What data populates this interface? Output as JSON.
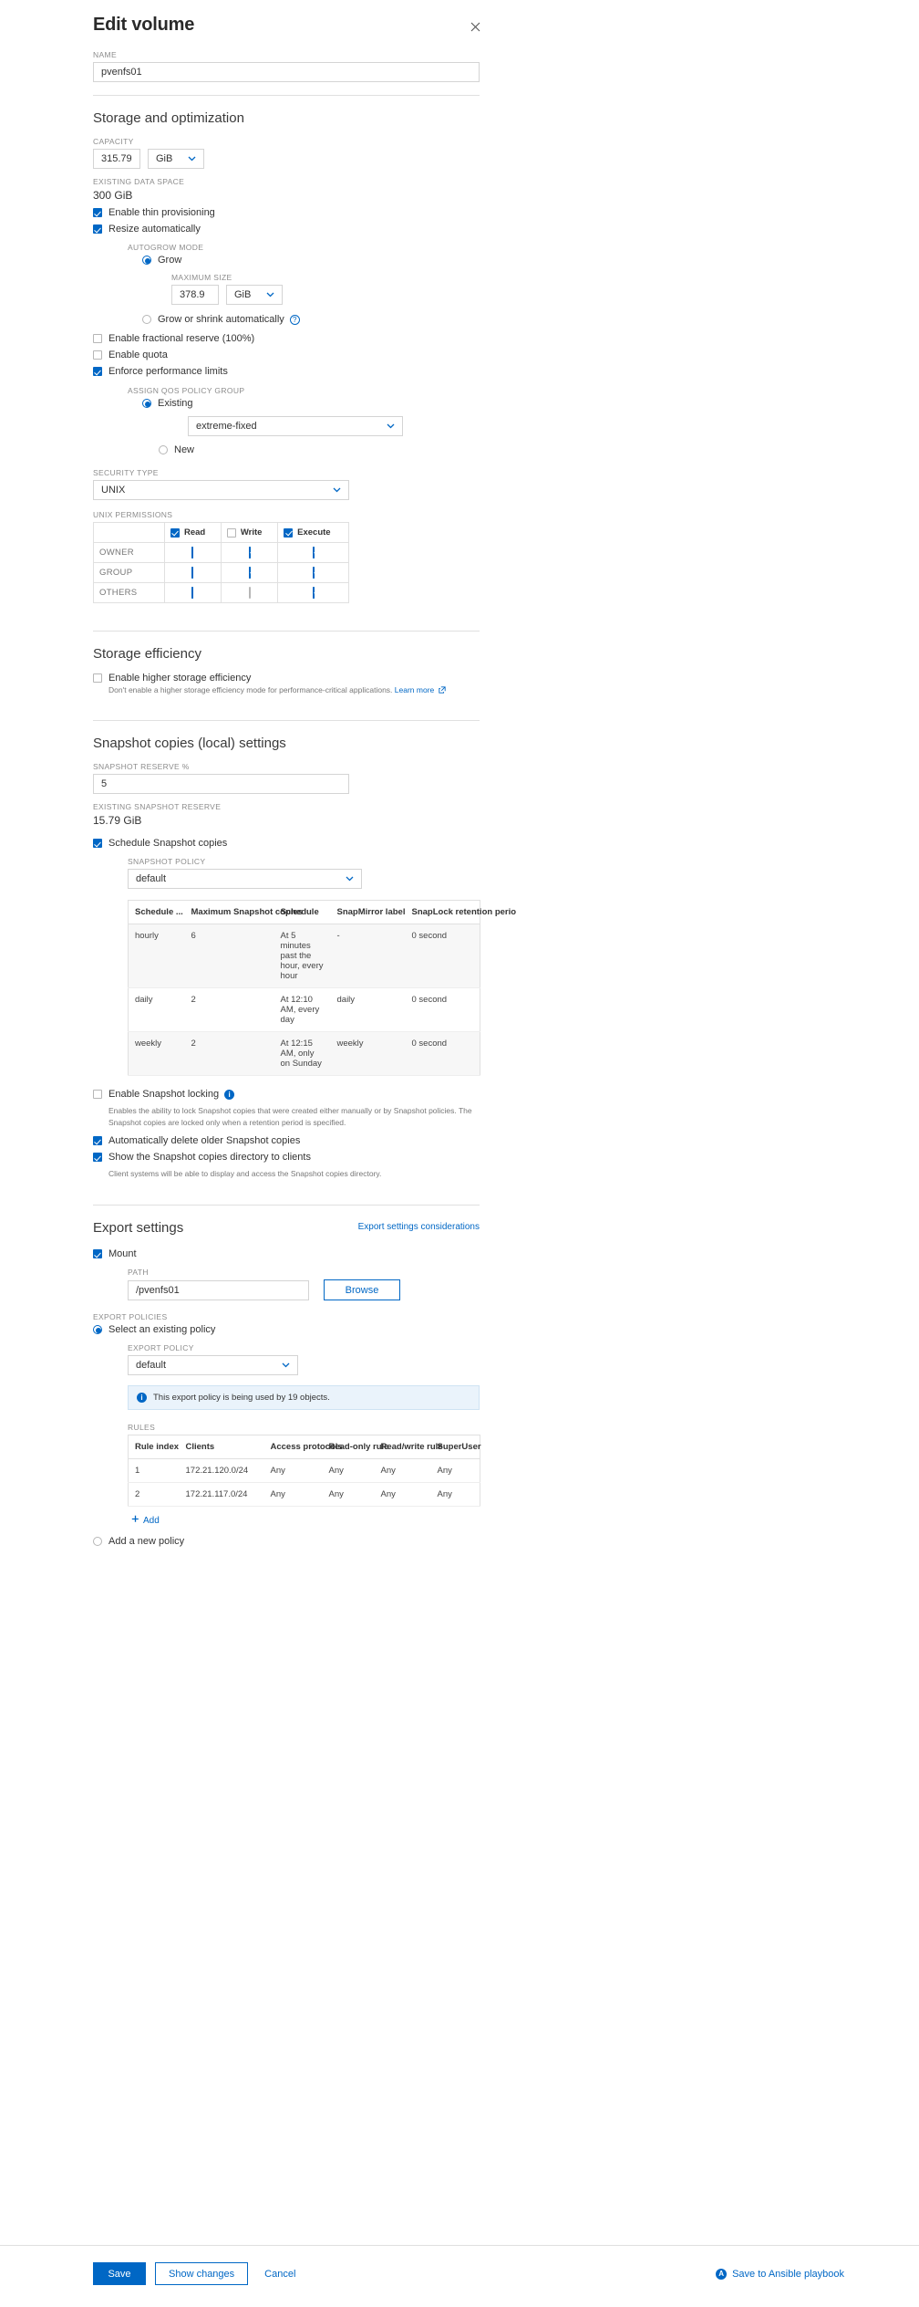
{
  "dialog": {
    "title": "Edit volume",
    "close_icon": "close-icon"
  },
  "name_field": {
    "label": "NAME",
    "value": "pvenfs01"
  },
  "storage": {
    "heading": "Storage and optimization",
    "capacity_label": "CAPACITY",
    "capacity_value": "315.79",
    "capacity_unit": "GiB",
    "existing_data_space_label": "EXISTING DATA SPACE",
    "existing_data_space_value": "300 GiB",
    "thin_provisioning_label": "Enable thin provisioning",
    "thin_provisioning_checked": true,
    "resize_auto_label": "Resize automatically",
    "resize_auto_checked": true,
    "autogrow_mode_label": "AUTOGROW MODE",
    "grow_label": "Grow",
    "grow_selected": true,
    "maximum_size_label": "MAXIMUM SIZE",
    "maximum_size_value": "378.9",
    "maximum_size_unit": "GiB",
    "grow_shrink_label": "Grow or shrink automatically",
    "grow_shrink_selected": false,
    "help_icon": "help-circle-icon",
    "fractional_reserve_label": "Enable fractional reserve (100%)",
    "fractional_reserve_checked": false,
    "quota_label": "Enable quota",
    "quota_checked": false,
    "perf_limits_label": "Enforce performance limits",
    "perf_limits_checked": true,
    "qos_group_label": "ASSIGN QOS POLICY GROUP",
    "qos_existing_label": "Existing",
    "qos_existing_selected": true,
    "qos_policy_value": "extreme-fixed",
    "qos_new_label": "New",
    "qos_new_selected": false,
    "security_type_label": "SECURITY TYPE",
    "security_type_value": "UNIX",
    "unix_permissions_label": "UNIX PERMISSIONS"
  },
  "unix_permissions": {
    "columns": [
      "Read",
      "Write",
      "Execute"
    ],
    "header_checked": [
      true,
      false,
      true
    ],
    "rows": [
      {
        "label": "OWNER",
        "values": [
          true,
          true,
          true
        ]
      },
      {
        "label": "GROUP",
        "values": [
          true,
          true,
          true
        ]
      },
      {
        "label": "OTHERS",
        "values": [
          true,
          false,
          true
        ]
      }
    ]
  },
  "storage_efficiency": {
    "heading": "Storage efficiency",
    "checkbox_label": "Enable higher storage efficiency",
    "checked": false,
    "note": "Don't enable a higher storage efficiency mode for performance-critical applications.",
    "learn_more": "Learn more",
    "external_icon": "external-link-icon"
  },
  "snapshot": {
    "heading": "Snapshot copies (local) settings",
    "reserve_label": "SNAPSHOT RESERVE %",
    "reserve_value": "5",
    "existing_reserve_label": "EXISTING SNAPSHOT RESERVE",
    "existing_reserve_value": "15.79 GiB",
    "schedule_label": "Schedule Snapshot copies",
    "schedule_checked": true,
    "policy_label": "SNAPSHOT POLICY",
    "policy_value": "default",
    "table": {
      "columns": [
        "Schedule ...",
        "Maximum Snapshot copies",
        "Schedule",
        "SnapMirror label",
        "SnapLock retention perio"
      ],
      "rows": [
        [
          "hourly",
          "6",
          "At 5 minutes past the hour, every hour",
          "-",
          "0 second"
        ],
        [
          "daily",
          "2",
          "At 12:10 AM, every day",
          "daily",
          "0 second"
        ],
        [
          "weekly",
          "2",
          "At 12:15 AM, only on Sunday",
          "weekly",
          "0 second"
        ]
      ]
    },
    "locking_label": "Enable Snapshot locking",
    "locking_checked": false,
    "locking_info_icon": "info-icon",
    "locking_note": "Enables the ability to lock Snapshot copies that were created either manually or by Snapshot policies. The Snapshot copies are locked only when a retention period is specified.",
    "auto_delete_label": "Automatically delete older Snapshot copies",
    "auto_delete_checked": true,
    "show_dir_label": "Show the Snapshot copies directory to clients",
    "show_dir_checked": true,
    "show_dir_note": "Client systems will be able to display and access the Snapshot copies directory."
  },
  "export": {
    "heading": "Export settings",
    "considerations_link": "Export settings considerations",
    "mount_label": "Mount",
    "mount_checked": true,
    "path_label": "PATH",
    "path_value": "/pvenfs01",
    "browse_label": "Browse",
    "policies_label": "EXPORT POLICIES",
    "select_existing_label": "Select an existing policy",
    "select_existing_selected": true,
    "export_policy_label": "EXPORT POLICY",
    "export_policy_value": "default",
    "notice_text": "This export policy is being used by 19 objects.",
    "notice_icon": "info-icon",
    "rules_label": "RULES",
    "rules_columns": [
      "Rule index",
      "Clients",
      "Access protocols",
      "Read-only rule",
      "Read/write rule",
      "SuperUser"
    ],
    "rules_rows": [
      [
        "1",
        "172.21.120.0/24",
        "Any",
        "Any",
        "Any",
        "Any"
      ],
      [
        "2",
        "172.21.117.0/24",
        "Any",
        "Any",
        "Any",
        "Any"
      ]
    ],
    "add_label": "Add",
    "add_icon": "plus-icon",
    "add_new_policy_label": "Add a new policy",
    "add_new_policy_selected": false
  },
  "footer": {
    "save_label": "Save",
    "show_changes_label": "Show changes",
    "cancel_label": "Cancel",
    "ansible_label": "Save to Ansible playbook",
    "ansible_icon": "ansible-icon"
  },
  "colors": {
    "accent": "#0067c5",
    "border": "#e0e0e0",
    "muted": "#8c8c8c"
  }
}
